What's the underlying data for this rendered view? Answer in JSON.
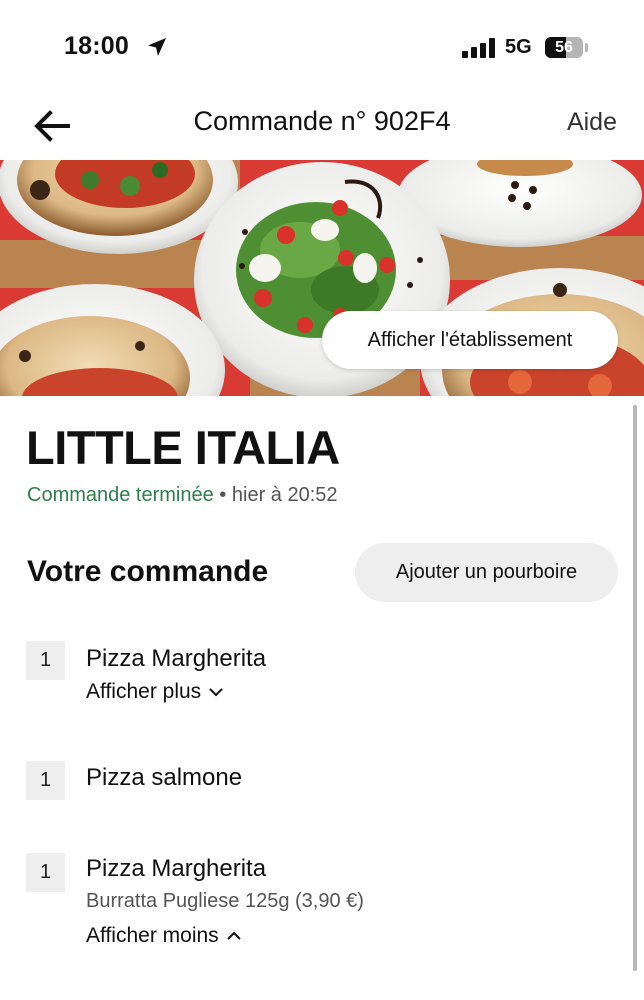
{
  "status_bar": {
    "time": "18:00",
    "network": "5G",
    "battery": "56",
    "battery_level": 0.56
  },
  "nav": {
    "title": "Commande n° 902F4",
    "help": "Aide"
  },
  "hero": {
    "view_store_label": "Afficher l'établissement"
  },
  "restaurant": {
    "name": "LITTLE ITALIA",
    "status": "Commande terminée",
    "separator": " • ",
    "time": "hier à 20:52"
  },
  "order": {
    "section_title": "Votre commande",
    "tip_label": "Ajouter un pourboire",
    "items": [
      {
        "qty": "1",
        "name": "Pizza Margherita",
        "toggle": "Afficher plus"
      },
      {
        "qty": "1",
        "name": "Pizza salmone"
      },
      {
        "qty": "1",
        "name": "Pizza Margherita",
        "option": "Burratta Pugliese 125g (3,90 €)",
        "toggle": "Afficher moins"
      }
    ]
  },
  "colors": {
    "success": "#2e7d4f",
    "chip_bg": "#eeeeee"
  }
}
